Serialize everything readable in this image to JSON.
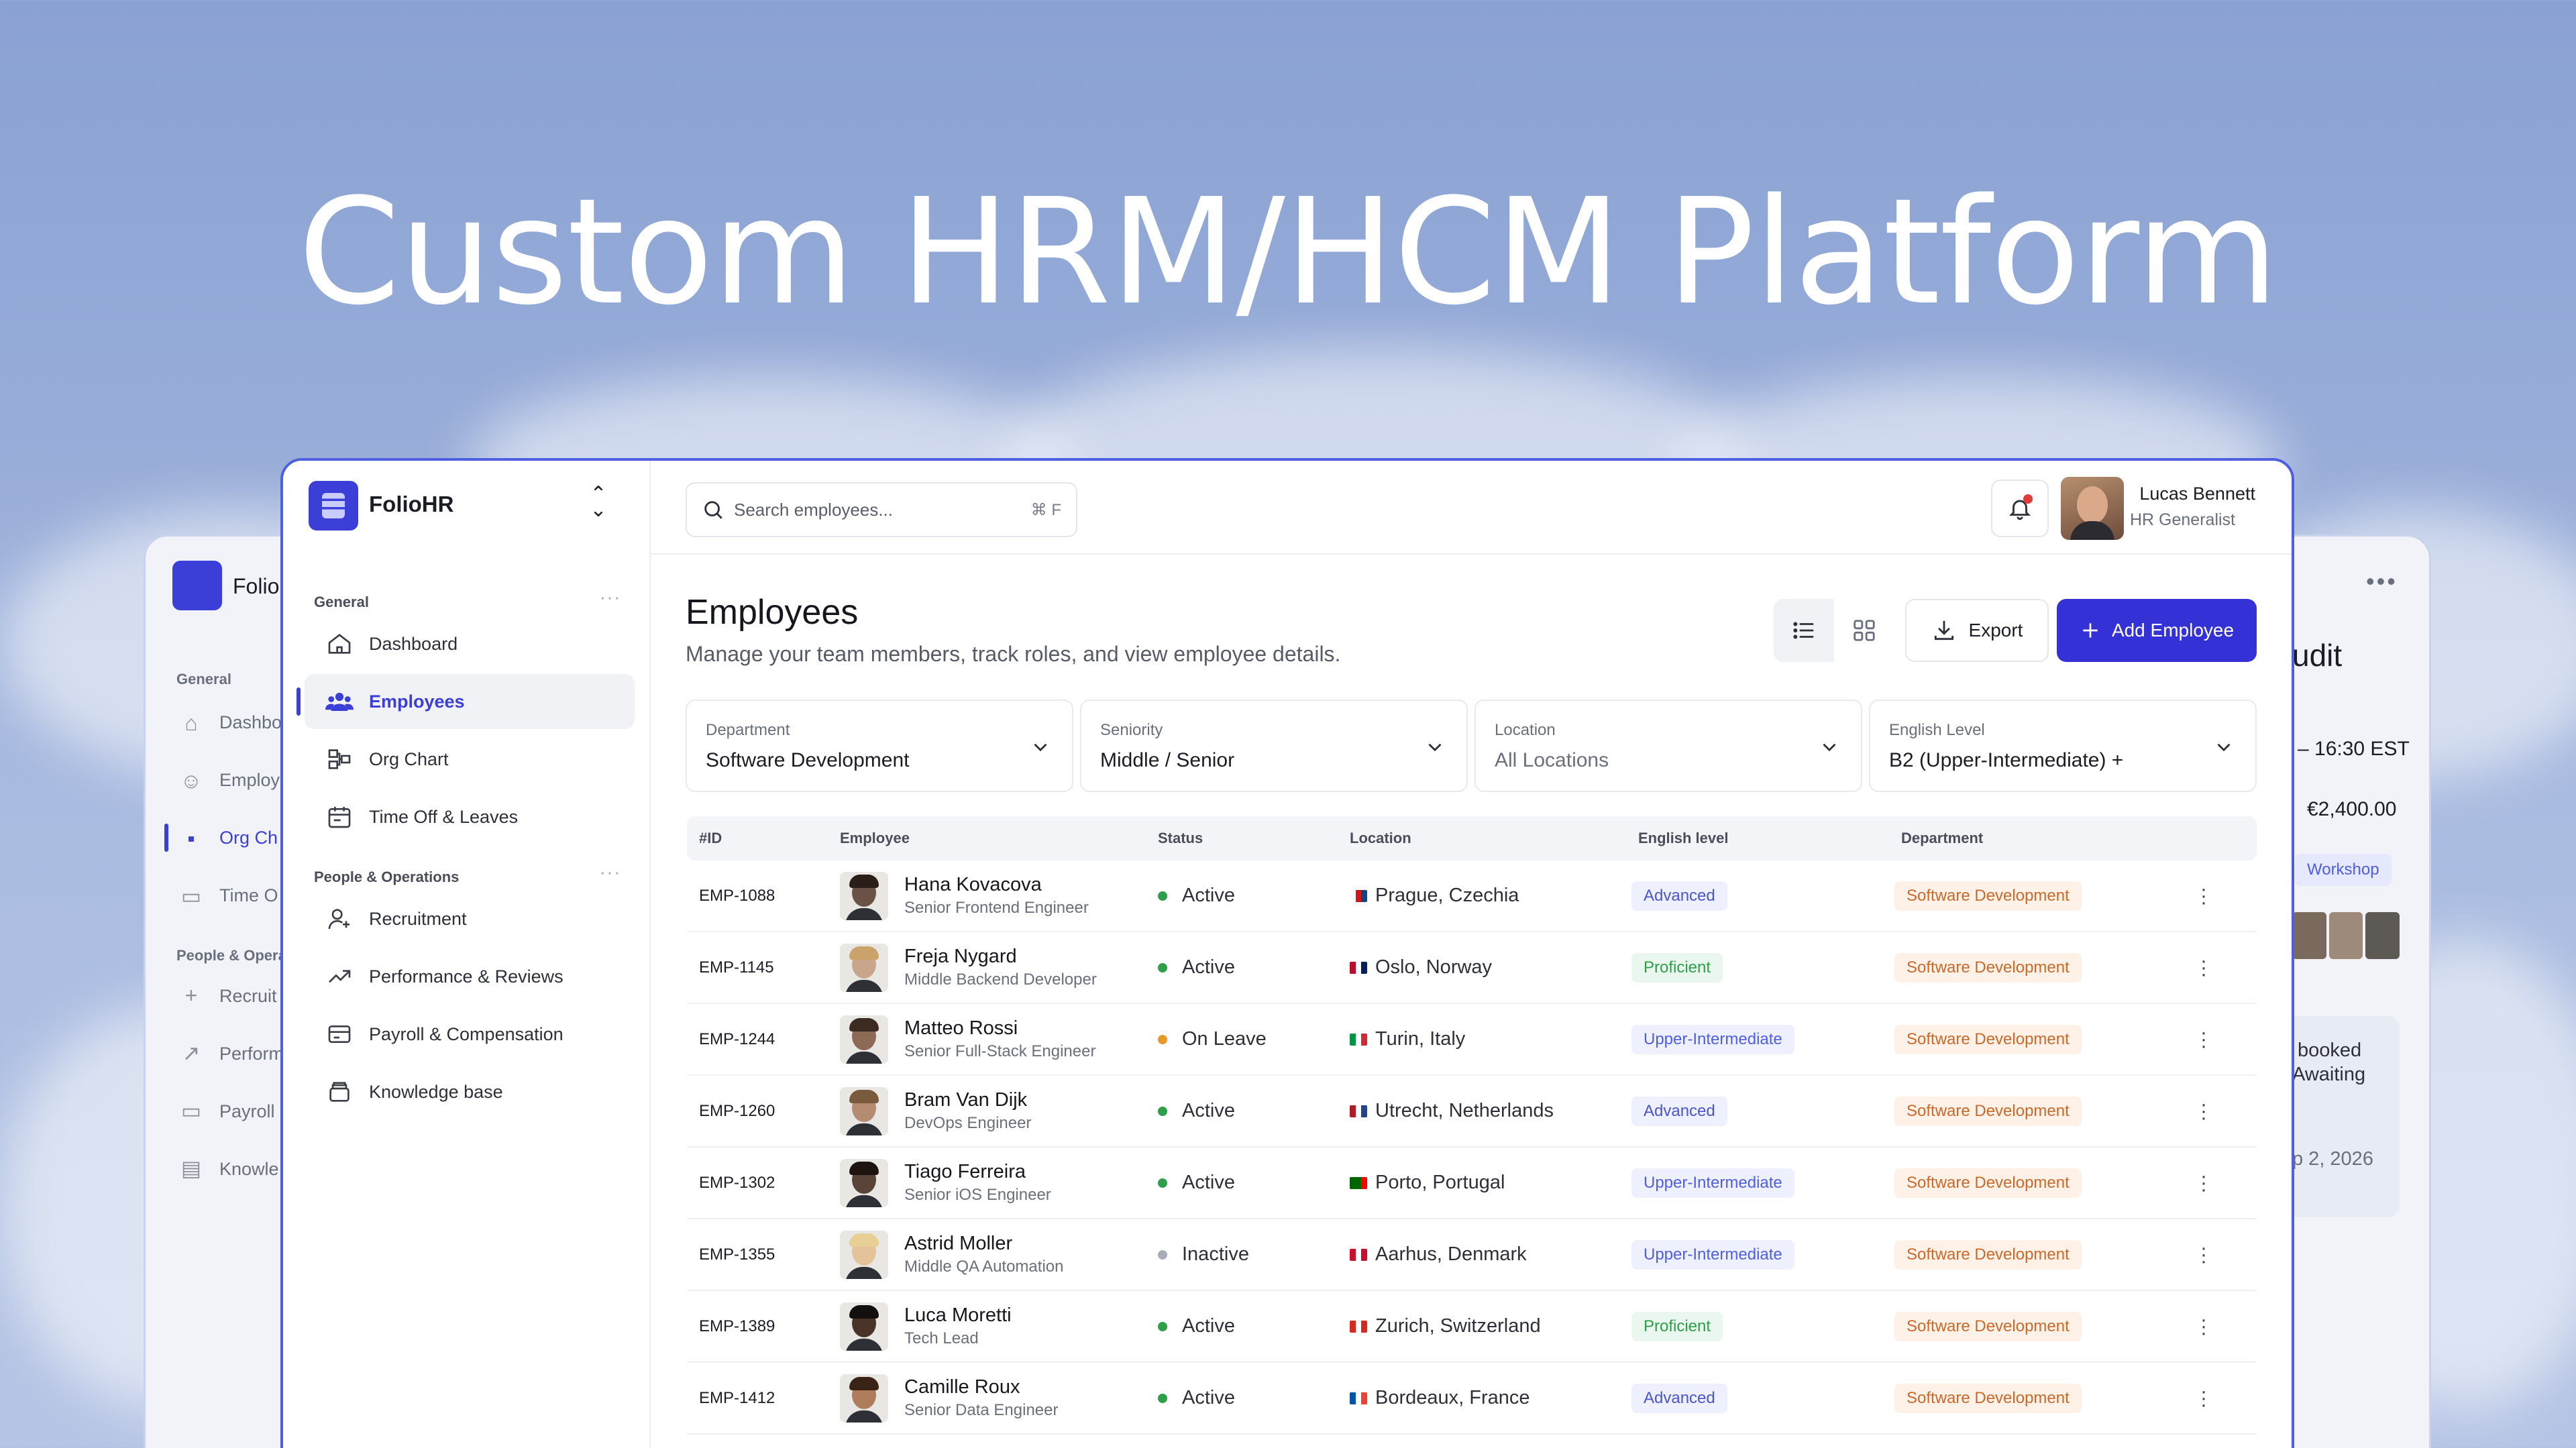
{
  "hero_title": "Custom HRM/HCM Platform",
  "back_window": {
    "brand": "Folio",
    "section_general": "General",
    "nav": [
      "Dashbo",
      "Employ",
      "Org Ch",
      "Time O"
    ],
    "section_people": "People & Opera",
    "nav2": [
      "Recruit",
      "Perform",
      "Payroll",
      "Knowle"
    ],
    "right": {
      "heading": "udit",
      "time": "– 16:30 EST",
      "amount": "€2,400.00",
      "tag": "Workshop",
      "note_line1": "booked",
      "note_line2": "Awaiting",
      "date": "p 2, 2026"
    }
  },
  "sidebar": {
    "brand": "FolioHR",
    "section_general": "General",
    "section_people": "People & Operations",
    "items_general": [
      {
        "label": "Dashboard",
        "icon": "home-icon"
      },
      {
        "label": "Employees",
        "icon": "users-icon",
        "active": true
      },
      {
        "label": "Org Chart",
        "icon": "org-chart-icon"
      },
      {
        "label": "Time Off & Leaves",
        "icon": "calendar-icon"
      }
    ],
    "items_people": [
      {
        "label": "Recruitment",
        "icon": "user-plus-icon"
      },
      {
        "label": "Performance & Reviews",
        "icon": "trend-icon"
      },
      {
        "label": "Payroll & Compensation",
        "icon": "card-icon"
      },
      {
        "label": "Knowledge base",
        "icon": "archive-icon"
      }
    ]
  },
  "topbar": {
    "search_placeholder": "Search employees...",
    "shortcut": "⌘ F",
    "user_name": "Lucas Bennett",
    "user_role": "HR Generalist"
  },
  "page": {
    "title": "Employees",
    "subtitle": "Manage your team members, track roles, and view employee details.",
    "export_label": "Export",
    "add_label": "Add Employee"
  },
  "filters": [
    {
      "label": "Department",
      "value": "Software Development"
    },
    {
      "label": "Seniority",
      "value": "Middle / Senior"
    },
    {
      "label": "Location",
      "value": "All Locations"
    },
    {
      "label": "English Level",
      "value": "B2 (Upper-Intermediate) +"
    }
  ],
  "table": {
    "headers": [
      "#ID",
      "Employee",
      "Status",
      "Location",
      "English level",
      "Department"
    ],
    "rows": [
      {
        "id": "EMP-1088",
        "name": "Hana Kovacova",
        "role": "Senior Frontend Engineer",
        "status": "Active",
        "location": "Prague, Czechia",
        "english": "Advanced",
        "department": "Software Development"
      },
      {
        "id": "EMP-1145",
        "name": "Freja Nygard",
        "role": "Middle Backend Developer",
        "status": "Active",
        "location": "Oslo, Norway",
        "english": "Proficient",
        "department": "Software Development"
      },
      {
        "id": "EMP-1244",
        "name": "Matteo Rossi",
        "role": "Senior Full-Stack Engineer",
        "status": "On Leave",
        "location": "Turin, Italy",
        "english": "Upper-Intermediate",
        "department": "Software Development"
      },
      {
        "id": "EMP-1260",
        "name": "Bram Van Dijk",
        "role": "DevOps Engineer",
        "status": "Active",
        "location": "Utrecht, Netherlands",
        "english": "Advanced",
        "department": "Software Development"
      },
      {
        "id": "EMP-1302",
        "name": "Tiago Ferreira",
        "role": "Senior iOS Engineer",
        "status": "Active",
        "location": "Porto, Portugal",
        "english": "Upper-Intermediate",
        "department": "Software Development"
      },
      {
        "id": "EMP-1355",
        "name": "Astrid Moller",
        "role": "Middle QA Automation",
        "status": "Inactive",
        "location": "Aarhus, Denmark",
        "english": "Upper-Intermediate",
        "department": "Software Development"
      },
      {
        "id": "EMP-1389",
        "name": "Luca Moretti",
        "role": "Tech Lead",
        "status": "Active",
        "location": "Zurich, Switzerland",
        "english": "Proficient",
        "department": "Software Development"
      },
      {
        "id": "EMP-1412",
        "name": "Camille Roux",
        "role": "Senior Data Engineer",
        "status": "Active",
        "location": "Bordeaux, France",
        "english": "Advanced",
        "department": "Software Development"
      }
    ]
  },
  "colors": {
    "accent": "#3432d6",
    "active": "#2e9e4a",
    "on_leave": "#e59a2b",
    "inactive": "#a9adb6",
    "department_badge": "#c96a2a"
  }
}
